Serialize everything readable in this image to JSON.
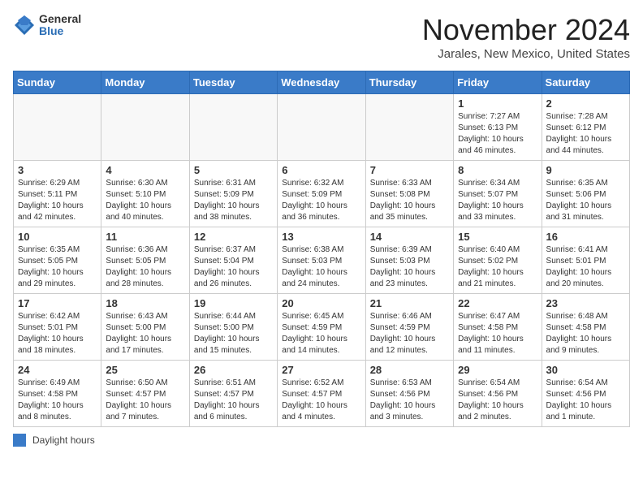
{
  "header": {
    "logo_general": "General",
    "logo_blue": "Blue",
    "month_title": "November 2024",
    "location": "Jarales, New Mexico, United States"
  },
  "days_of_week": [
    "Sunday",
    "Monday",
    "Tuesday",
    "Wednesday",
    "Thursday",
    "Friday",
    "Saturday"
  ],
  "legend_label": "Daylight hours",
  "weeks": [
    [
      {
        "day": "",
        "info": ""
      },
      {
        "day": "",
        "info": ""
      },
      {
        "day": "",
        "info": ""
      },
      {
        "day": "",
        "info": ""
      },
      {
        "day": "",
        "info": ""
      },
      {
        "day": "1",
        "info": "Sunrise: 7:27 AM\nSunset: 6:13 PM\nDaylight: 10 hours and 46 minutes."
      },
      {
        "day": "2",
        "info": "Sunrise: 7:28 AM\nSunset: 6:12 PM\nDaylight: 10 hours and 44 minutes."
      }
    ],
    [
      {
        "day": "3",
        "info": "Sunrise: 6:29 AM\nSunset: 5:11 PM\nDaylight: 10 hours and 42 minutes."
      },
      {
        "day": "4",
        "info": "Sunrise: 6:30 AM\nSunset: 5:10 PM\nDaylight: 10 hours and 40 minutes."
      },
      {
        "day": "5",
        "info": "Sunrise: 6:31 AM\nSunset: 5:09 PM\nDaylight: 10 hours and 38 minutes."
      },
      {
        "day": "6",
        "info": "Sunrise: 6:32 AM\nSunset: 5:09 PM\nDaylight: 10 hours and 36 minutes."
      },
      {
        "day": "7",
        "info": "Sunrise: 6:33 AM\nSunset: 5:08 PM\nDaylight: 10 hours and 35 minutes."
      },
      {
        "day": "8",
        "info": "Sunrise: 6:34 AM\nSunset: 5:07 PM\nDaylight: 10 hours and 33 minutes."
      },
      {
        "day": "9",
        "info": "Sunrise: 6:35 AM\nSunset: 5:06 PM\nDaylight: 10 hours and 31 minutes."
      }
    ],
    [
      {
        "day": "10",
        "info": "Sunrise: 6:35 AM\nSunset: 5:05 PM\nDaylight: 10 hours and 29 minutes."
      },
      {
        "day": "11",
        "info": "Sunrise: 6:36 AM\nSunset: 5:05 PM\nDaylight: 10 hours and 28 minutes."
      },
      {
        "day": "12",
        "info": "Sunrise: 6:37 AM\nSunset: 5:04 PM\nDaylight: 10 hours and 26 minutes."
      },
      {
        "day": "13",
        "info": "Sunrise: 6:38 AM\nSunset: 5:03 PM\nDaylight: 10 hours and 24 minutes."
      },
      {
        "day": "14",
        "info": "Sunrise: 6:39 AM\nSunset: 5:03 PM\nDaylight: 10 hours and 23 minutes."
      },
      {
        "day": "15",
        "info": "Sunrise: 6:40 AM\nSunset: 5:02 PM\nDaylight: 10 hours and 21 minutes."
      },
      {
        "day": "16",
        "info": "Sunrise: 6:41 AM\nSunset: 5:01 PM\nDaylight: 10 hours and 20 minutes."
      }
    ],
    [
      {
        "day": "17",
        "info": "Sunrise: 6:42 AM\nSunset: 5:01 PM\nDaylight: 10 hours and 18 minutes."
      },
      {
        "day": "18",
        "info": "Sunrise: 6:43 AM\nSunset: 5:00 PM\nDaylight: 10 hours and 17 minutes."
      },
      {
        "day": "19",
        "info": "Sunrise: 6:44 AM\nSunset: 5:00 PM\nDaylight: 10 hours and 15 minutes."
      },
      {
        "day": "20",
        "info": "Sunrise: 6:45 AM\nSunset: 4:59 PM\nDaylight: 10 hours and 14 minutes."
      },
      {
        "day": "21",
        "info": "Sunrise: 6:46 AM\nSunset: 4:59 PM\nDaylight: 10 hours and 12 minutes."
      },
      {
        "day": "22",
        "info": "Sunrise: 6:47 AM\nSunset: 4:58 PM\nDaylight: 10 hours and 11 minutes."
      },
      {
        "day": "23",
        "info": "Sunrise: 6:48 AM\nSunset: 4:58 PM\nDaylight: 10 hours and 9 minutes."
      }
    ],
    [
      {
        "day": "24",
        "info": "Sunrise: 6:49 AM\nSunset: 4:58 PM\nDaylight: 10 hours and 8 minutes."
      },
      {
        "day": "25",
        "info": "Sunrise: 6:50 AM\nSunset: 4:57 PM\nDaylight: 10 hours and 7 minutes."
      },
      {
        "day": "26",
        "info": "Sunrise: 6:51 AM\nSunset: 4:57 PM\nDaylight: 10 hours and 6 minutes."
      },
      {
        "day": "27",
        "info": "Sunrise: 6:52 AM\nSunset: 4:57 PM\nDaylight: 10 hours and 4 minutes."
      },
      {
        "day": "28",
        "info": "Sunrise: 6:53 AM\nSunset: 4:56 PM\nDaylight: 10 hours and 3 minutes."
      },
      {
        "day": "29",
        "info": "Sunrise: 6:54 AM\nSunset: 4:56 PM\nDaylight: 10 hours and 2 minutes."
      },
      {
        "day": "30",
        "info": "Sunrise: 6:54 AM\nSunset: 4:56 PM\nDaylight: 10 hours and 1 minute."
      }
    ]
  ]
}
